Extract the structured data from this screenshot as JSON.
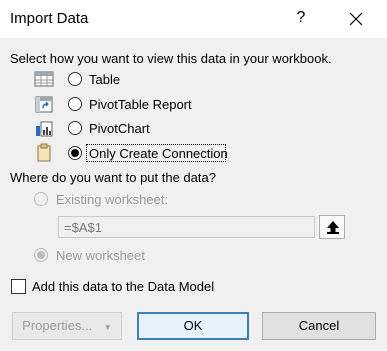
{
  "dialog": {
    "title": "Import Data",
    "help_glyph": "?",
    "close_icon": "close-icon"
  },
  "view_section": {
    "prompt": "Select how you want to view this data in your workbook.",
    "options": [
      {
        "label": "Table",
        "icon": "table-icon",
        "checked": false
      },
      {
        "label": "PivotTable Report",
        "icon": "pivottable-icon",
        "checked": false
      },
      {
        "label": "PivotChart",
        "icon": "pivotchart-icon",
        "checked": false
      },
      {
        "label": "Only Create Connection",
        "icon": "connection-icon",
        "checked": true
      }
    ]
  },
  "location_section": {
    "prompt": "Where do you want to put the data?",
    "existing_label": "Existing worksheet:",
    "range_value": "=$A$1",
    "new_label": "New worksheet"
  },
  "data_model": {
    "label": "Add this data to the Data Model",
    "checked": false
  },
  "buttons": {
    "properties": "Properties...",
    "ok": "OK",
    "cancel": "Cancel"
  },
  "colors": {
    "ok_border": "#3c7fb1",
    "ok_background": "#e5f1fb",
    "dialog_background": "#f0f0f0"
  }
}
